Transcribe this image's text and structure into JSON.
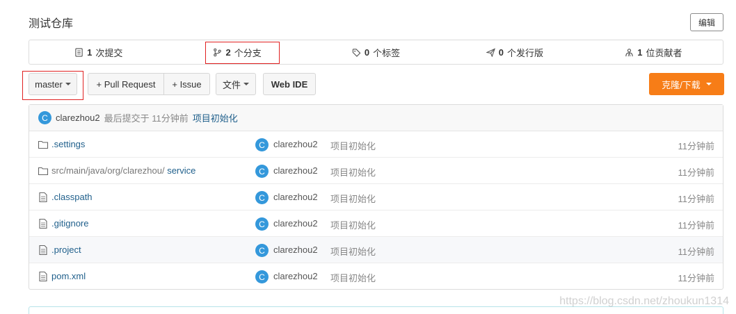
{
  "repo": {
    "title": "测试仓库",
    "edit_label": "编辑"
  },
  "stats": [
    {
      "icon": "commit-icon",
      "count": "1",
      "label": "次提交"
    },
    {
      "icon": "branch-icon",
      "count": "2",
      "label": "个分支"
    },
    {
      "icon": "tag-icon",
      "count": "0",
      "label": "个标签"
    },
    {
      "icon": "release-icon",
      "count": "0",
      "label": "个发行版"
    },
    {
      "icon": "contributor-icon",
      "count": "1",
      "label": "位贡献者"
    }
  ],
  "toolbar": {
    "branch": "master",
    "pull_request": "+ Pull Request",
    "issue": "+ Issue",
    "files": "文件",
    "web_ide": "Web IDE",
    "clone": "克隆/下载"
  },
  "last_commit": {
    "avatar": "C",
    "author": "clarezhou2",
    "meta": "最后提交于 11分钟前",
    "message": "项目初始化"
  },
  "files": [
    {
      "type": "folder",
      "dir": "",
      "name": ".settings",
      "avatar": "C",
      "author": "clarezhou2",
      "message": "项目初始化",
      "time": "11分钟前"
    },
    {
      "type": "folder",
      "dir": "src/main/java/org/clarezhou/ ",
      "name": "service",
      "avatar": "C",
      "author": "clarezhou2",
      "message": "项目初始化",
      "time": "11分钟前"
    },
    {
      "type": "file",
      "dir": "",
      "name": ".classpath",
      "avatar": "C",
      "author": "clarezhou2",
      "message": "项目初始化",
      "time": "11分钟前"
    },
    {
      "type": "file",
      "dir": "",
      "name": ".gitignore",
      "avatar": "C",
      "author": "clarezhou2",
      "message": "项目初始化",
      "time": "11分钟前"
    },
    {
      "type": "file",
      "dir": "",
      "name": ".project",
      "avatar": "C",
      "author": "clarezhou2",
      "message": "项目初始化",
      "time": "11分钟前"
    },
    {
      "type": "file",
      "dir": "",
      "name": "pom.xml",
      "avatar": "C",
      "author": "clarezhou2",
      "message": "项目初始化",
      "time": "11分钟前"
    }
  ],
  "watermark": "https://blog.csdn.net/zhoukun1314"
}
